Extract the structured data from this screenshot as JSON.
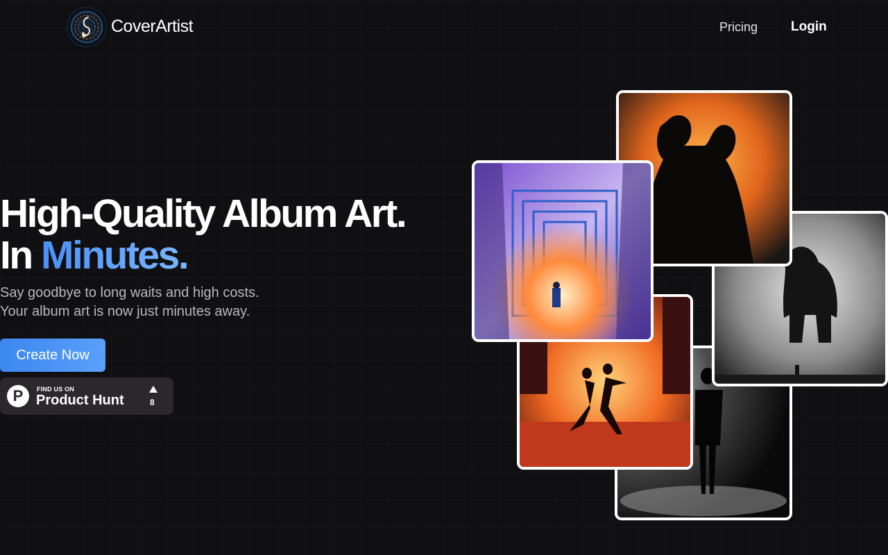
{
  "header": {
    "brand": "CoverArtist",
    "logo_icon": "music-note-logo-icon",
    "nav": {
      "pricing": "Pricing",
      "login": "Login"
    }
  },
  "hero": {
    "title_line1": "High-Quality Album Art.",
    "title_line2_prefix": "In ",
    "title_line2_accent": "Minutes.",
    "subtitle_line1": "Say goodbye to long waits and high costs.",
    "subtitle_line2": "Your album art is now just minutes away.",
    "cta": "Create Now",
    "accent_color": "#4a90f5"
  },
  "product_hunt": {
    "small_label": "FIND US ON",
    "big_label": "Product Hunt",
    "logo_letter": "P",
    "upvotes": "8"
  },
  "gallery": [
    {
      "name": "couple-silhouette-orange-art"
    },
    {
      "name": "watercolor-maze-forest-art"
    },
    {
      "name": "monster-in-fog-art"
    },
    {
      "name": "dancing-couple-fire-art"
    },
    {
      "name": "man-in-shadows-art"
    }
  ]
}
